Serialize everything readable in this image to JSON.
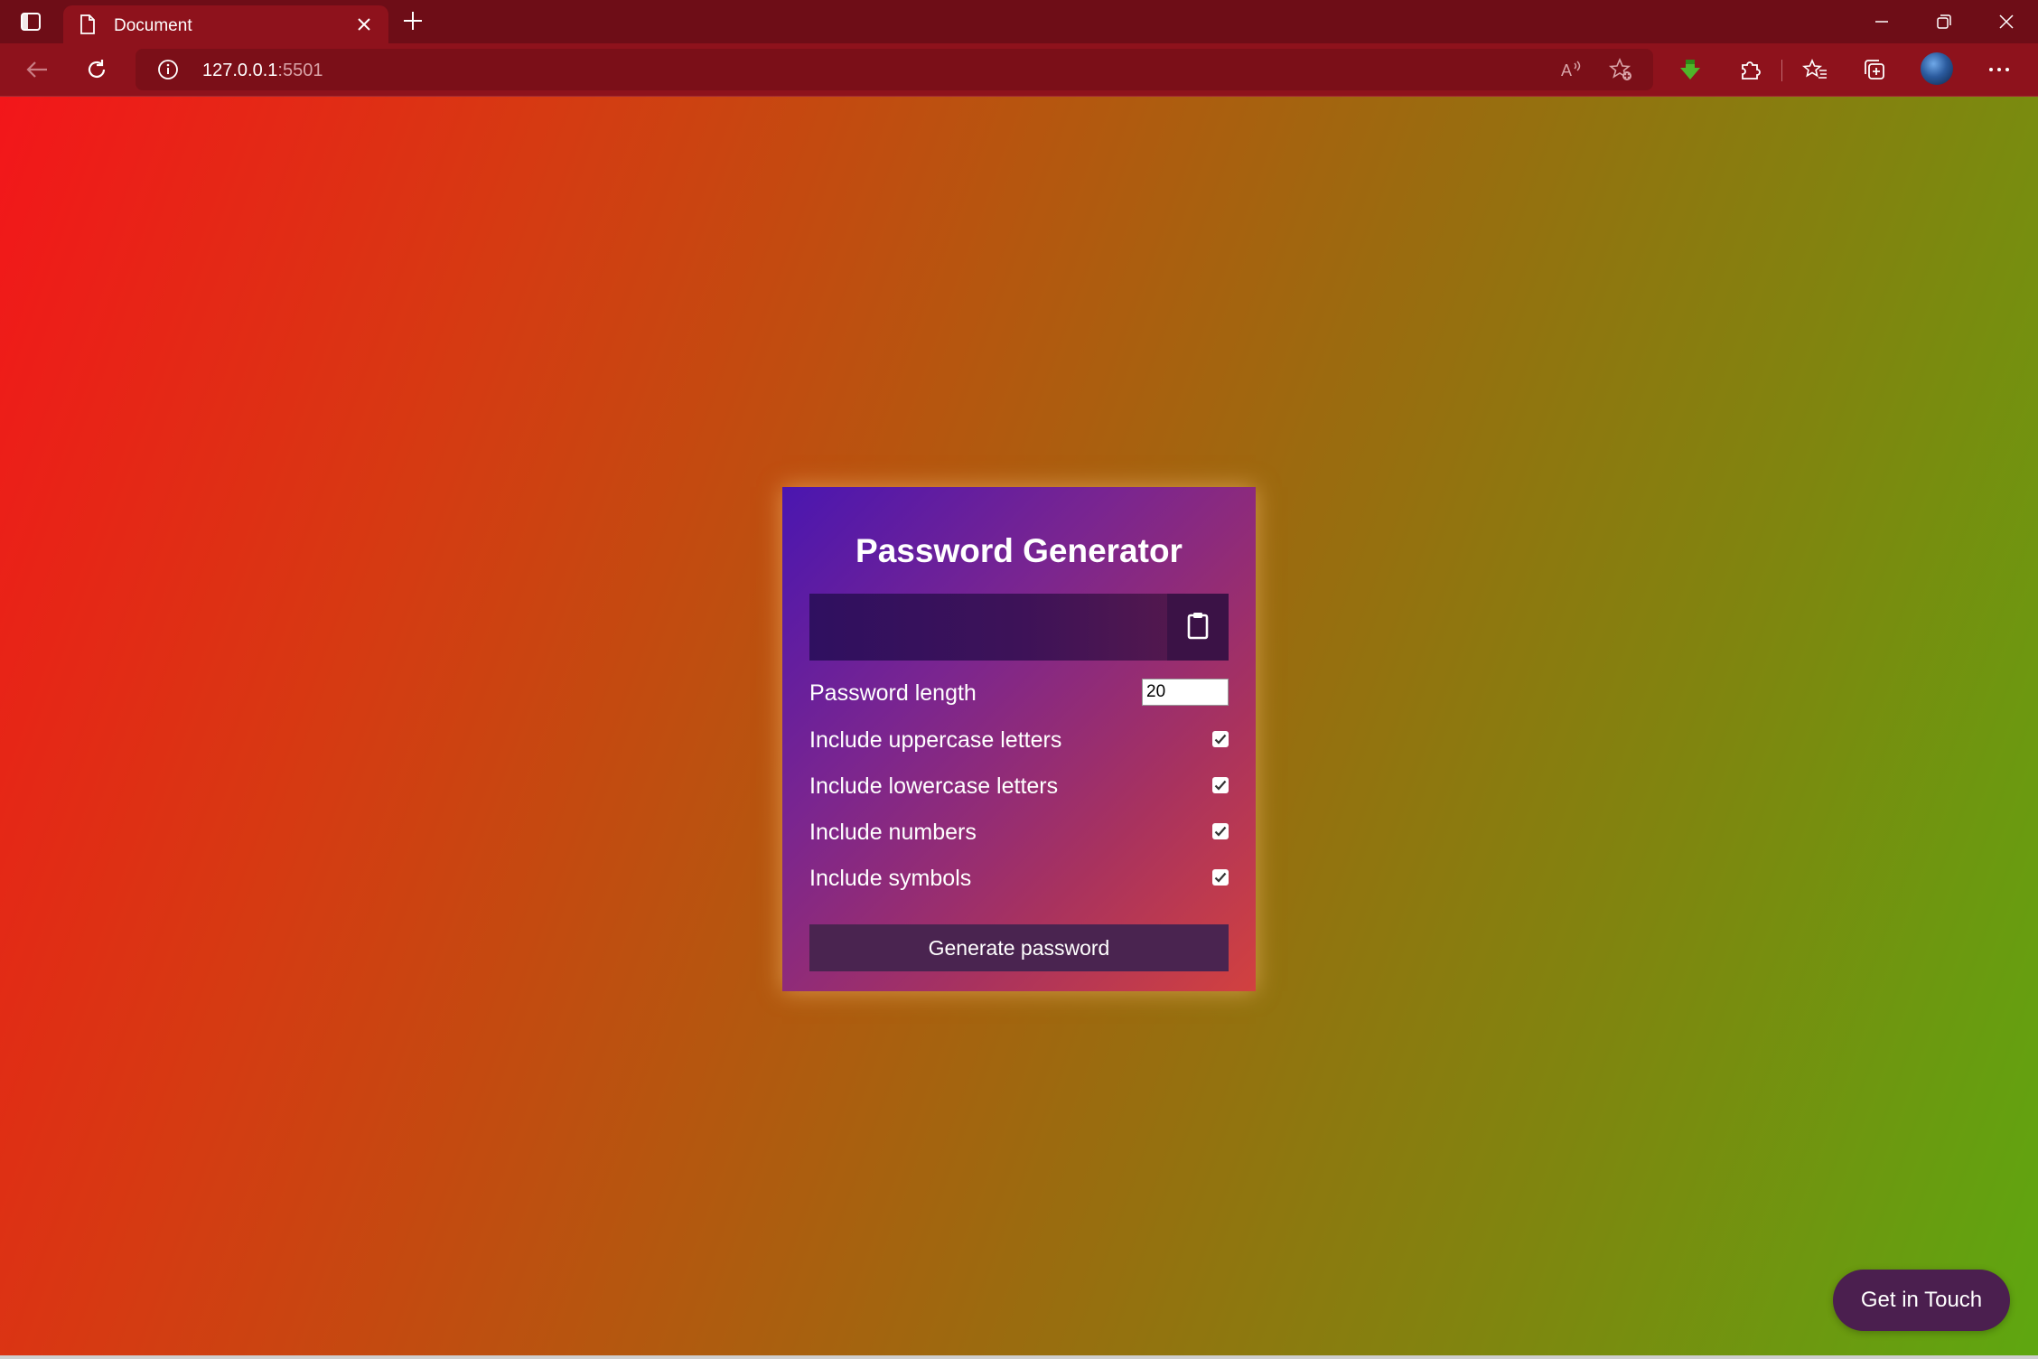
{
  "browser": {
    "tab_title": "Document",
    "url_host": "127.0.0.1",
    "url_port": ":5501",
    "icons": [
      "tab-actions-icon",
      "document-icon",
      "close-icon",
      "new-tab-icon",
      "minimize-icon",
      "restore-icon",
      "window-close-icon",
      "back-icon",
      "refresh-icon",
      "info-icon",
      "read-aloud-icon",
      "add-favorite-icon",
      "download-extension-icon",
      "extensions-icon",
      "favorites-icon",
      "collections-icon",
      "profile-avatar",
      "more-icon"
    ]
  },
  "app": {
    "title": "Password Generator",
    "result_value": "",
    "clipboard_icon": "clipboard-icon",
    "settings": [
      {
        "label": "Password length",
        "type": "number",
        "value": "20"
      },
      {
        "label": "Include uppercase letters",
        "type": "checkbox",
        "checked": true
      },
      {
        "label": "Include lowercase letters",
        "type": "checkbox",
        "checked": true
      },
      {
        "label": "Include numbers",
        "type": "checkbox",
        "checked": true
      },
      {
        "label": "Include symbols",
        "type": "checkbox",
        "checked": true
      }
    ],
    "generate_label": "Generate password"
  },
  "contact": {
    "label": "Get in Touch"
  },
  "colors": {
    "card_gradient_start": "#4a16b0",
    "card_gradient_end": "#d2413f",
    "page_gradient_start": "#f3161a",
    "page_gradient_end": "#5ea710",
    "button_bg": "#4a2450"
  }
}
